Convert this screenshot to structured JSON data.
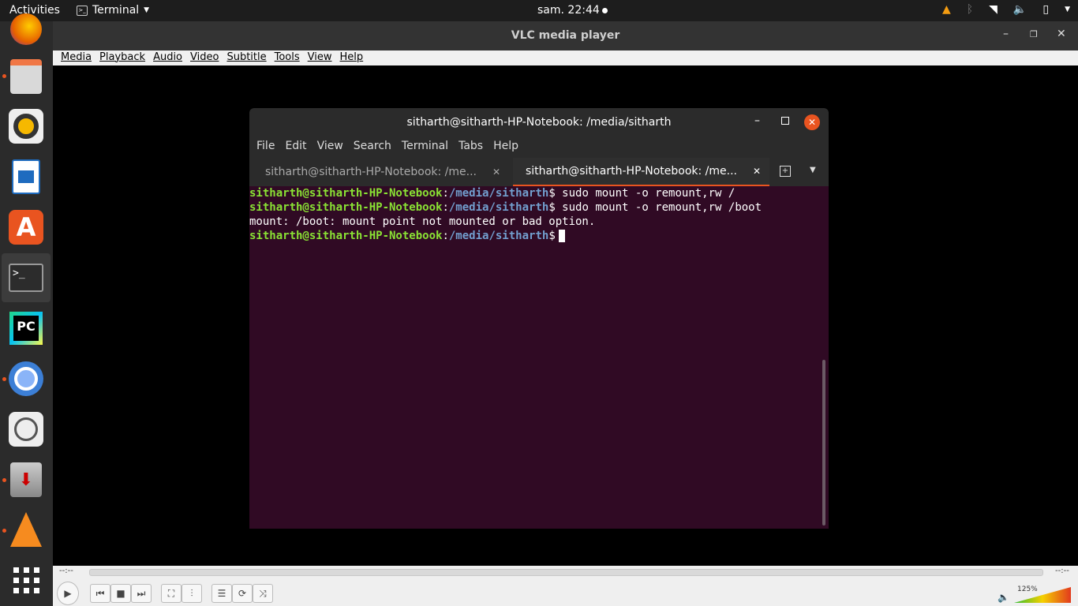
{
  "topbar": {
    "activities": "Activities",
    "app_name": "Terminal",
    "clock": "sam. 22:44"
  },
  "vlc": {
    "title": "VLC media player",
    "menu": [
      "Media",
      "Playback",
      "Audio",
      "Video",
      "Subtitle",
      "Tools",
      "View",
      "Help"
    ],
    "time_elapsed": "--:--",
    "time_total": "--:--",
    "volume": "125%",
    "volume_level": 1.0
  },
  "terminal": {
    "title": "sitharth@sitharth-HP-Notebook: /media/sitharth",
    "menu": [
      "File",
      "Edit",
      "View",
      "Search",
      "Terminal",
      "Tabs",
      "Help"
    ],
    "tabs": [
      {
        "label": "sitharth@sitharth-HP-Notebook: /me..."
      },
      {
        "label": "sitharth@sitharth-HP-Notebook: /me..."
      }
    ],
    "lines": [
      {
        "user": "sitharth@sitharth-HP-Notebook",
        "path": "/media/sitharth",
        "cmd": " sudo mount -o remount,rw /"
      },
      {
        "user": "sitharth@sitharth-HP-Notebook",
        "path": "/media/sitharth",
        "cmd": " sudo mount -o remount,rw /boot"
      },
      {
        "output": "mount: /boot: mount point not mounted or bad option."
      },
      {
        "user": "sitharth@sitharth-HP-Notebook",
        "path": "/media/sitharth",
        "cmd": ""
      }
    ]
  },
  "dock": {
    "icons": [
      "firefox-icon",
      "files-icon",
      "rhythmbox-icon",
      "writer-icon",
      "software-icon",
      "terminal-icon",
      "pycharm-icon",
      "chromium-icon",
      "image-viewer-icon",
      "installer-icon",
      "vlc-icon",
      "apps-grid-icon"
    ]
  },
  "colors": {
    "terminal_bg": "#300a24",
    "prompt_user": "#8ae234",
    "prompt_path": "#729fcf",
    "close_button": "#e95420"
  }
}
